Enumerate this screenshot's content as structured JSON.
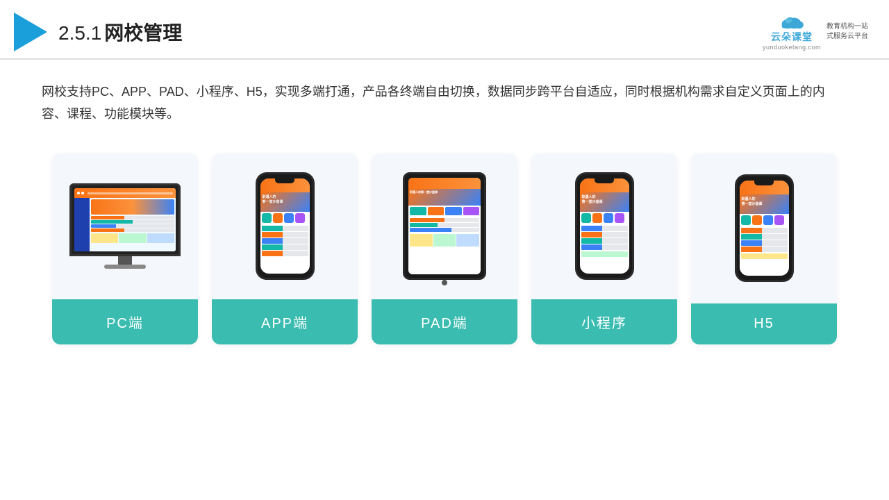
{
  "header": {
    "page_number": "2.5.1",
    "page_title": "网校管理",
    "brand": {
      "name": "云朵课堂",
      "url": "yunduoketang.com",
      "tagline_line1": "教育机构一站",
      "tagline_line2": "式服务云平台"
    }
  },
  "description": {
    "text": "网校支持PC、APP、PAD、小程序、H5，实现多端打通，产品各终端自由切换，数据同步跨平台自适应，同时根据机构需求自定义页面上的内容、课程、功能模块等。"
  },
  "cards": [
    {
      "id": "pc",
      "label": "PC端"
    },
    {
      "id": "app",
      "label": "APP端"
    },
    {
      "id": "pad",
      "label": "PAD端"
    },
    {
      "id": "miniapp",
      "label": "小程序"
    },
    {
      "id": "h5",
      "label": "H5"
    }
  ]
}
